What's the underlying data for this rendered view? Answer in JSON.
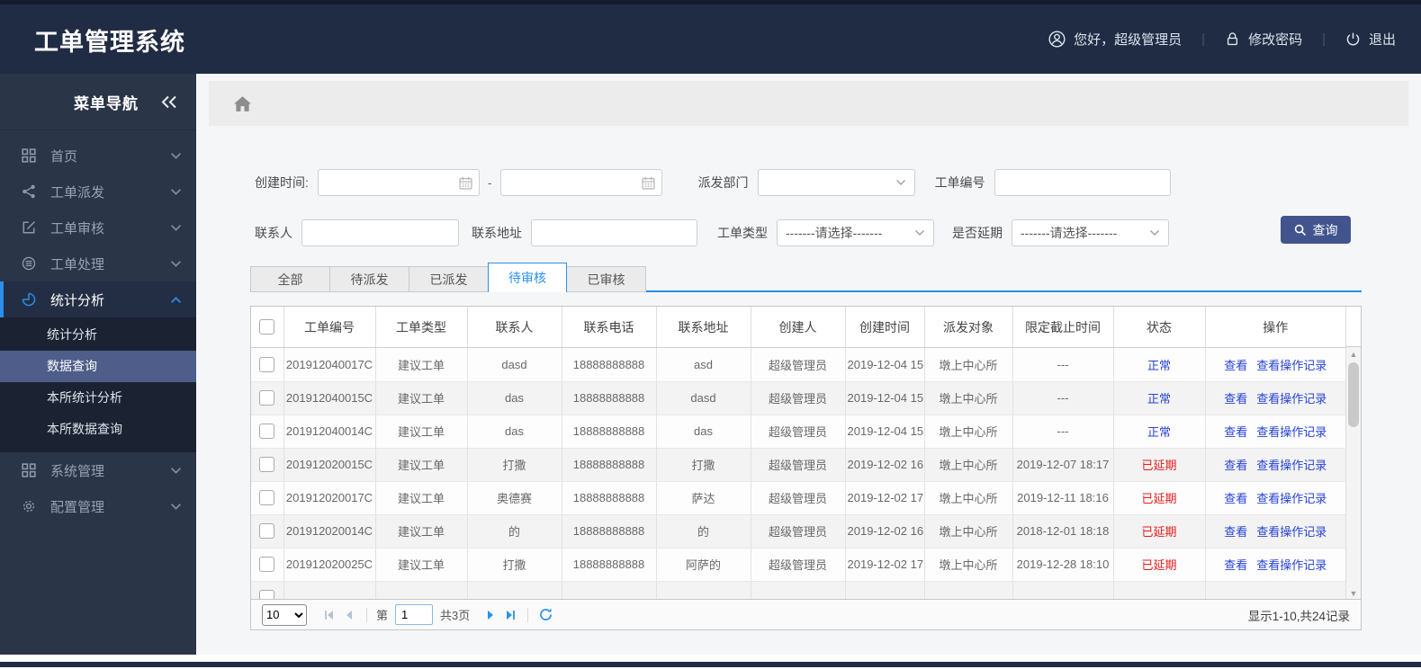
{
  "colors": {
    "header_bg": "#202c44",
    "sidebar_bg": "#2a3548",
    "submenu_bg": "#1b2332",
    "submenu_selected_bg": "#4e5d89",
    "accent_blue": "#2b8fe8",
    "link_blue": "#2743d6",
    "status_normal_blue": "#2743d6",
    "status_delayed_red": "#e51c1c",
    "query_button_bg": "#42548e"
  },
  "header": {
    "title": "工单管理系统",
    "greeting": "您好，超级管理员",
    "change_password": "修改密码",
    "logout": "退出"
  },
  "sidebar": {
    "title": "菜单导航",
    "items": [
      {
        "label": "首页",
        "icon": "grid-icon"
      },
      {
        "label": "工单派发",
        "icon": "share-icon"
      },
      {
        "label": "工单审核",
        "icon": "edit-icon"
      },
      {
        "label": "工单处理",
        "icon": "process-icon"
      },
      {
        "label": "统计分析",
        "icon": "pie-chart-icon",
        "active": true,
        "children": [
          {
            "label": "统计分析"
          },
          {
            "label": "数据查询",
            "selected": true
          },
          {
            "label": "本所统计分析"
          },
          {
            "label": "本所数据查询"
          }
        ]
      },
      {
        "label": "系统管理",
        "icon": "grid-icon"
      },
      {
        "label": "配置管理",
        "icon": "gear-icon"
      }
    ]
  },
  "filters": {
    "created_time_label": "创建时间:",
    "range_separator": "-",
    "dispatch_dept_label": "派发部门",
    "order_no_label": "工单编号",
    "contact_label": "联系人",
    "address_label": "联系地址",
    "order_type_label": "工单类型",
    "delay_label": "是否延期",
    "select_placeholder": "-------请选择-------",
    "query_button": "查询"
  },
  "tabs": [
    {
      "label": "全部"
    },
    {
      "label": "待派发"
    },
    {
      "label": "已派发"
    },
    {
      "label": "待审核",
      "active": true
    },
    {
      "label": "已审核"
    }
  ],
  "table": {
    "columns": [
      "工单编号",
      "工单类型",
      "联系人",
      "联系电话",
      "联系地址",
      "创建人",
      "创建时间",
      "派发对象",
      "限定截止时间",
      "状态",
      "操作"
    ],
    "actions": {
      "view": "查看",
      "view_log": "查看操作记录"
    },
    "rows": [
      {
        "order_no": "201912040017C",
        "type": "建议工单",
        "contact": "dasd",
        "phone": "18888888888",
        "address": "asd",
        "creator": "超级管理员",
        "created": "2019-12-04 15",
        "target": "墩上中心所",
        "deadline": "---",
        "status": "正常",
        "status_type": "normal"
      },
      {
        "order_no": "201912040015C",
        "type": "建议工单",
        "contact": "das",
        "phone": "18888888888",
        "address": "dasd",
        "creator": "超级管理员",
        "created": "2019-12-04 15",
        "target": "墩上中心所",
        "deadline": "---",
        "status": "正常",
        "status_type": "normal"
      },
      {
        "order_no": "201912040014C",
        "type": "建议工单",
        "contact": "das",
        "phone": "18888888888",
        "address": "das",
        "creator": "超级管理员",
        "created": "2019-12-04 15",
        "target": "墩上中心所",
        "deadline": "---",
        "status": "正常",
        "status_type": "normal"
      },
      {
        "order_no": "201912020015C",
        "type": "建议工单",
        "contact": "打撒",
        "phone": "18888888888",
        "address": "打撒",
        "creator": "超级管理员",
        "created": "2019-12-02 16",
        "target": "墩上中心所",
        "deadline": "2019-12-07 18:17",
        "status": "已延期",
        "status_type": "delayed"
      },
      {
        "order_no": "201912020017C",
        "type": "建议工单",
        "contact": "奥德赛",
        "phone": "18888888888",
        "address": "萨达",
        "creator": "超级管理员",
        "created": "2019-12-02 17",
        "target": "墩上中心所",
        "deadline": "2019-12-11 18:16",
        "status": "已延期",
        "status_type": "delayed"
      },
      {
        "order_no": "201912020014C",
        "type": "建议工单",
        "contact": "的",
        "phone": "18888888888",
        "address": "的",
        "creator": "超级管理员",
        "created": "2019-12-02 16",
        "target": "墩上中心所",
        "deadline": "2018-12-01 18:18",
        "status": "已延期",
        "status_type": "delayed"
      },
      {
        "order_no": "201912020025C",
        "type": "建议工单",
        "contact": "打撒",
        "phone": "18888888888",
        "address": "阿萨的",
        "creator": "超级管理员",
        "created": "2019-12-02 17",
        "target": "墩上中心所",
        "deadline": "2019-12-28 18:10",
        "status": "已延期",
        "status_type": "delayed"
      }
    ]
  },
  "pagination": {
    "page_size": "10",
    "page_prefix_label": "第",
    "current_page": "1",
    "total_pages_label": "共3页",
    "summary": "显示1-10,共24记录"
  }
}
